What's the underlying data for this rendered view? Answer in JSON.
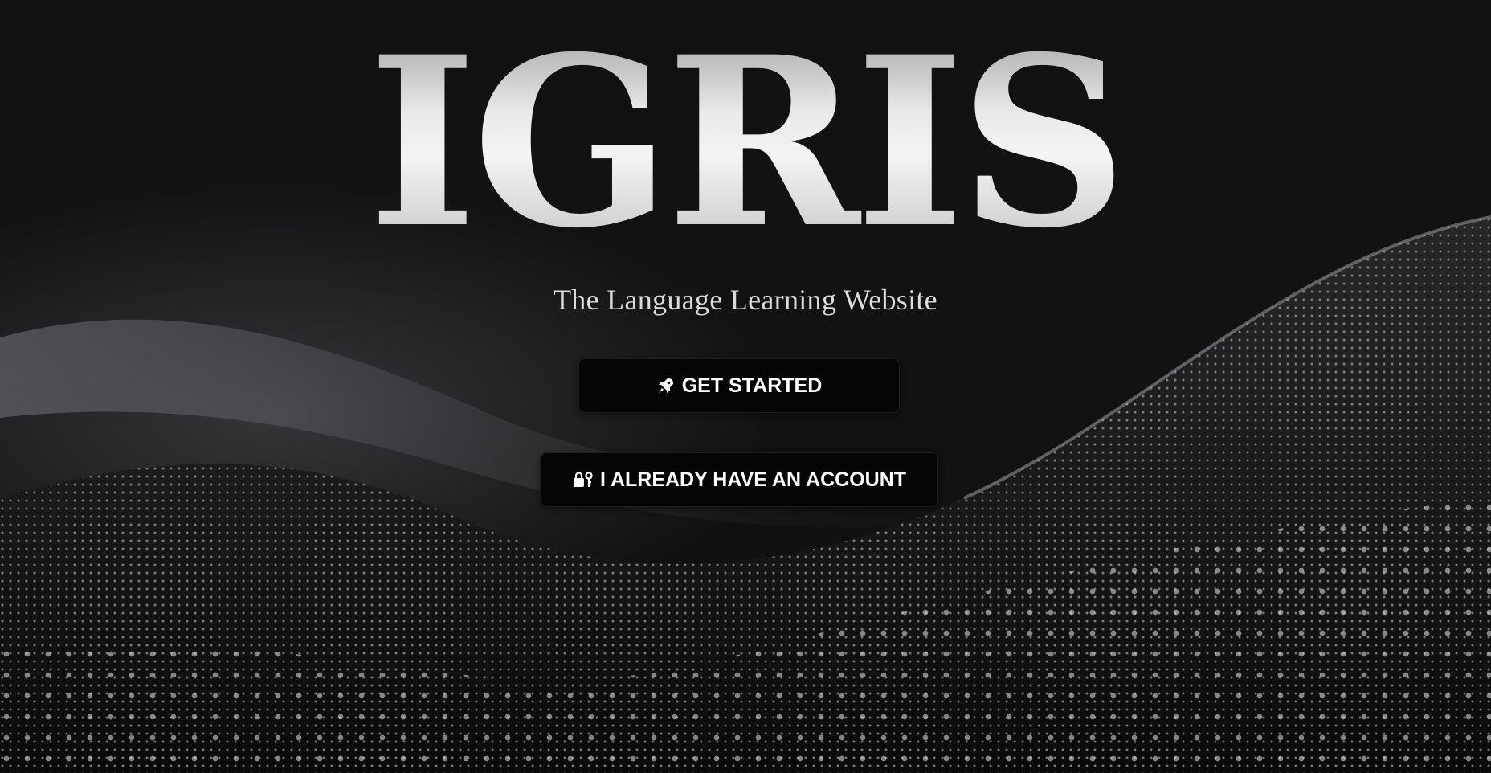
{
  "app": {
    "title": "IGRIS",
    "tagline": "The Language Learning Website"
  },
  "actions": {
    "get_started": {
      "label": "GET STARTED",
      "icon": "rocket-icon"
    },
    "have_account": {
      "label": "I ALREADY HAVE AN ACCOUNT",
      "icon": "lock-key-icon"
    }
  },
  "background": {
    "image": "particle-wave",
    "colors": {
      "base": "#0f0f10",
      "particles": "#d8d8d8",
      "button": "#050505",
      "text": "#ffffff"
    }
  }
}
